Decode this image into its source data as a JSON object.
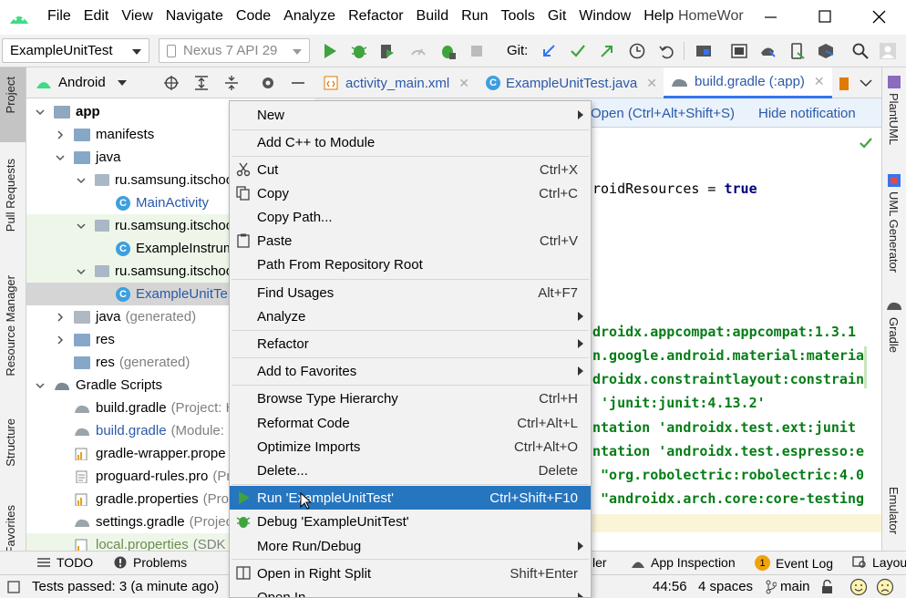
{
  "menubar": {
    "items": [
      "File",
      "Edit",
      "View",
      "Navigate",
      "Code",
      "Analyze",
      "Refactor",
      "Build",
      "Run",
      "Tools",
      "Git",
      "Window",
      "Help"
    ],
    "project_title": "HomeWor"
  },
  "toolbar": {
    "run_config": "ExampleUnitTest",
    "device": "Nexus 7 API 29",
    "git_label": "Git:"
  },
  "left_stripe": {
    "tabs": [
      "Project",
      "Pull Requests",
      "Resource Manager",
      "Structure",
      "Favorites"
    ]
  },
  "project_panel": {
    "view_mode": "Android",
    "tree": [
      {
        "label": "app",
        "bold": true
      },
      {
        "label": "manifests"
      },
      {
        "label": "java"
      },
      {
        "label": "ru.samsung.itschoo"
      },
      {
        "label": "MainActivity"
      },
      {
        "label": "ru.samsung.itschoo"
      },
      {
        "label": "ExampleInstrum"
      },
      {
        "label": "ru.samsung.itschoo"
      },
      {
        "label": "ExampleUnitTe"
      },
      {
        "label": "java",
        "hint": "(generated)"
      },
      {
        "label": "res"
      },
      {
        "label": "res",
        "hint": "(generated)"
      },
      {
        "label": "Gradle Scripts"
      },
      {
        "label": "build.gradle",
        "hint": "(Project: H"
      },
      {
        "label": "build.gradle",
        "hint": "(Module:"
      },
      {
        "label": "gradle-wrapper.prope"
      },
      {
        "label": "proguard-rules.pro",
        "hint": "(Pr"
      },
      {
        "label": "gradle.properties",
        "hint": "(Pro"
      },
      {
        "label": "settings.gradle",
        "hint": "(Projec"
      },
      {
        "label": "local.properties",
        "hint": "(SDK"
      }
    ]
  },
  "editor_tabs": [
    {
      "label": "activity_main.xml"
    },
    {
      "label": "ExampleUnitTest.java"
    },
    {
      "label": "build.gradle (:app)"
    }
  ],
  "notification": {
    "open_link": "Open (Ctrl+Alt+Shift+S)",
    "hide_link": "Hide notification"
  },
  "code_lines": [
    {
      "text": "roidResources = ",
      "kw": "true"
    },
    {
      "text": "droidx.appcompat:appcompat:1.3.1"
    },
    {
      "text": "n.google.android.material:materia"
    },
    {
      "text": "droidx.constraintlayout:constrain"
    },
    {
      "text": " 'junit:junit:4.13.2'"
    },
    {
      "text": "ntation 'androidx.test.ext:junit"
    },
    {
      "text": "ntation 'androidx.test.espresso:e"
    },
    {
      "text": " \"org.robolectric:robolectric:4.0"
    },
    {
      "text": " \"androidx.arch.core:core-testing"
    }
  ],
  "right_stripe": {
    "tabs": [
      "PlantUML",
      "UML Generator",
      "Gradle",
      "Emulator"
    ]
  },
  "context_menu": {
    "items": [
      {
        "label": "New",
        "submenu": true
      },
      {
        "label": "Add C++ to Module"
      },
      {
        "label": "Cut",
        "shortcut": "Ctrl+X",
        "icon": "cut-icon"
      },
      {
        "label": "Copy",
        "shortcut": "Ctrl+C",
        "icon": "copy-icon"
      },
      {
        "label": "Copy Path..."
      },
      {
        "label": "Paste",
        "shortcut": "Ctrl+V",
        "icon": "paste-icon"
      },
      {
        "label": "Path From Repository Root"
      },
      {
        "label": "Find Usages",
        "shortcut": "Alt+F7"
      },
      {
        "label": "Analyze",
        "submenu": true
      },
      {
        "label": "Refactor",
        "submenu": true
      },
      {
        "label": "Add to Favorites",
        "submenu": true
      },
      {
        "label": "Browse Type Hierarchy",
        "shortcut": "Ctrl+H"
      },
      {
        "label": "Reformat Code",
        "shortcut": "Ctrl+Alt+L"
      },
      {
        "label": "Optimize Imports",
        "shortcut": "Ctrl+Alt+O"
      },
      {
        "label": "Delete...",
        "shortcut": "Delete"
      },
      {
        "label": "Run 'ExampleUnitTest'",
        "shortcut": "Ctrl+Shift+F10",
        "icon": "run-icon",
        "selected": true
      },
      {
        "label": "Debug 'ExampleUnitTest'",
        "icon": "debug-icon"
      },
      {
        "label": "More Run/Debug",
        "submenu": true
      },
      {
        "label": "Open in Right Split",
        "shortcut": "Shift+Enter",
        "icon": "split-icon"
      },
      {
        "label": "Open In",
        "submenu": true
      }
    ]
  },
  "bottom_tools": {
    "todo": "TODO",
    "problems": "Problems",
    "profiler_tail": "ler",
    "app_inspection": "App Inspection",
    "event_log": "Event Log",
    "event_count": "1",
    "layout": "Layou"
  },
  "status": {
    "message": "Tests passed: 3 (a minute ago)",
    "position": "44:56",
    "indent": "4 spaces",
    "branch": "main"
  },
  "colors": {
    "accent_blue": "#2675bf",
    "string_green": "#067d17",
    "keyword_navy": "#000080",
    "run_green": "#3fa33f"
  }
}
